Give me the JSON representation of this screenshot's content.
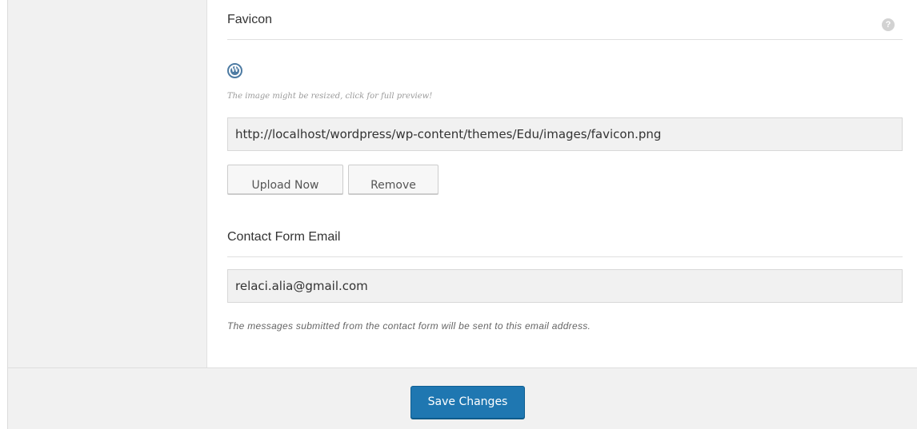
{
  "favicon": {
    "title": "Favicon",
    "help_icon": "question-mark-icon",
    "preview_icon": "wordpress-logo-icon",
    "preview_icon_glyph": "W",
    "hint": "The image might be resized, click for full preview!",
    "url_value": "http://localhost/wordpress/wp-content/themes/Edu/images/favicon.png",
    "upload_label": "Upload Now",
    "remove_label": "Remove"
  },
  "contact": {
    "title": "Contact Form Email",
    "email_value": "relaci.alia@gmail.com",
    "note": "The messages submitted from the contact form will be sent to this email address."
  },
  "footer": {
    "save_label": "Save Changes"
  },
  "colors": {
    "primary_button": "#1f77b1",
    "panel_background": "#f1f1f1",
    "wp_blue": "#4d7ba3"
  }
}
